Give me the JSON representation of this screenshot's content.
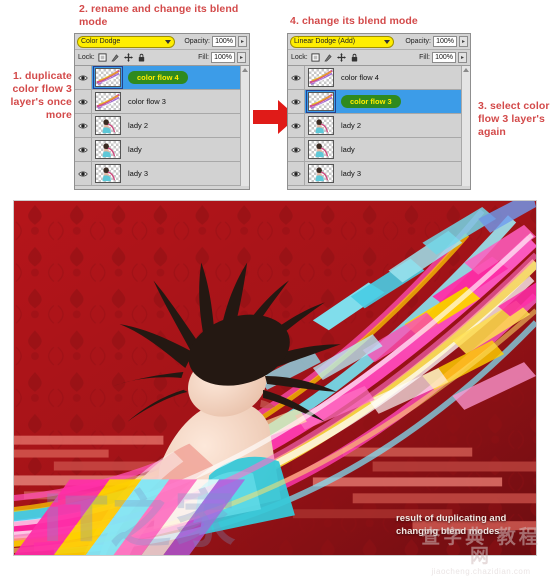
{
  "annotations": {
    "step1": "1. duplicate color flow 3 layer's once more",
    "step2": "2. rename and change its blend mode",
    "step3": "3. select color flow 3 layer's again",
    "step4": "4. change its blend mode"
  },
  "panel_left": {
    "blend_mode": "Color Dodge",
    "opacity_label": "Opacity:",
    "opacity_value": "100%",
    "lock_label": "Lock:",
    "fill_label": "Fill:",
    "fill_value": "100%",
    "lock_icons": [
      "lock-transparent-pixels-icon",
      "lock-image-pixels-icon",
      "lock-position-icon",
      "lock-all-icon"
    ],
    "layers": [
      {
        "name": "color flow 4",
        "selected": true,
        "renamed": true,
        "thumb": "color-flow-thumb",
        "visible": true
      },
      {
        "name": "color flow 3",
        "selected": false,
        "renamed": false,
        "thumb": "color-flow-thumb",
        "visible": true
      },
      {
        "name": "lady 2",
        "selected": false,
        "renamed": false,
        "thumb": "lady-thumb",
        "visible": true
      },
      {
        "name": "lady",
        "selected": false,
        "renamed": false,
        "thumb": "lady-thumb",
        "visible": true
      },
      {
        "name": "lady 3",
        "selected": false,
        "renamed": false,
        "thumb": "lady-thumb",
        "visible": true
      }
    ]
  },
  "panel_right": {
    "blend_mode": "Linear Dodge (Add)",
    "opacity_label": "Opacity:",
    "opacity_value": "100%",
    "lock_label": "Lock:",
    "fill_label": "Fill:",
    "fill_value": "100%",
    "lock_icons": [
      "lock-transparent-pixels-icon",
      "lock-image-pixels-icon",
      "lock-position-icon",
      "lock-all-icon"
    ],
    "layers": [
      {
        "name": "color flow 4",
        "selected": false,
        "renamed": false,
        "thumb": "color-flow-thumb",
        "visible": true
      },
      {
        "name": "color flow 3",
        "selected": true,
        "renamed": true,
        "thumb": "color-flow-thumb",
        "visible": true
      },
      {
        "name": "lady 2",
        "selected": false,
        "renamed": false,
        "thumb": "lady-thumb",
        "visible": true
      },
      {
        "name": "lady",
        "selected": false,
        "renamed": false,
        "thumb": "lady-thumb",
        "visible": true
      },
      {
        "name": "lady 3",
        "selected": false,
        "renamed": false,
        "thumb": "lady-thumb",
        "visible": true
      }
    ]
  },
  "artwork": {
    "caption_line1": "result of duplicating and",
    "caption_line2": "changing blend modes",
    "watermark_left": "iT之家",
    "watermark_cjk": "查字典 教程网",
    "watermark_url": "jiaocheng.chazidian.com"
  },
  "colors": {
    "annotation_red": "#d34a4a",
    "arrow_red": "#e01b18",
    "blend_highlight": "#ffee00",
    "layer_selected": "#3c9ce8",
    "rename_pill_bg": "#2f8a1f",
    "rename_pill_text": "#ffee00",
    "panel_bg": "#d4d4d4",
    "artwork_bg": "#a11216"
  }
}
